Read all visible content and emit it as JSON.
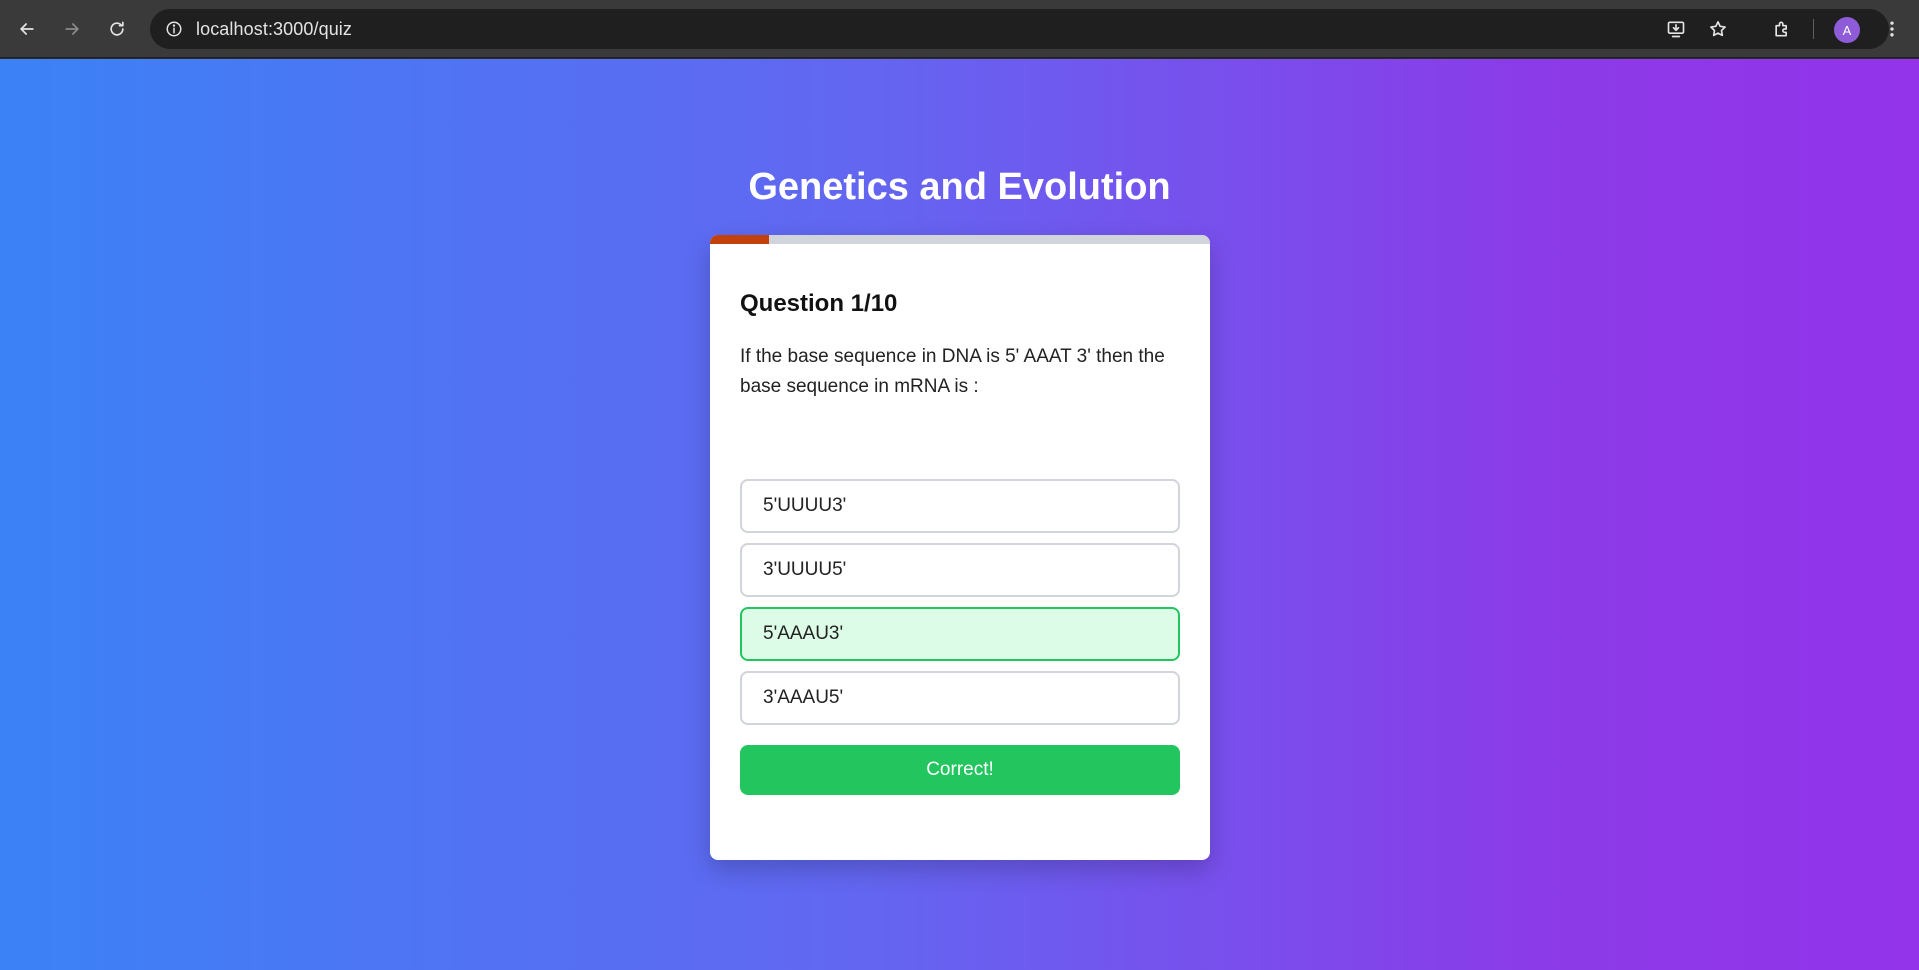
{
  "browser": {
    "url": "localhost:3000/quiz",
    "profile_initial": "A",
    "icons": [
      "back-icon",
      "forward-icon",
      "reload-icon",
      "site-info-icon",
      "install-app-icon",
      "bookmark-star-icon",
      "extensions-icon",
      "menu-kebab-icon"
    ]
  },
  "quiz": {
    "title": "Genetics and Evolution",
    "progress": {
      "current": 1,
      "total": 10,
      "fraction": 0.1
    },
    "question_label": "Question 1/10",
    "question_text": "If the base sequence in DNA is 5' AAAT 3' then the base sequence in mRNA is :",
    "options": [
      {
        "label": "5'UUUU3'",
        "state": "default"
      },
      {
        "label": "3'UUUU5'",
        "state": "default"
      },
      {
        "label": "5'AAAU3'",
        "state": "correct"
      },
      {
        "label": "3'AAAU5'",
        "state": "default"
      }
    ],
    "feedback_label": "Correct!"
  },
  "colors": {
    "gradient_start": "#3b82f6",
    "gradient_end": "#9333ea",
    "progress_fill": "#c2410c",
    "correct_green": "#22c55e",
    "correct_bg": "#dcfce7"
  }
}
